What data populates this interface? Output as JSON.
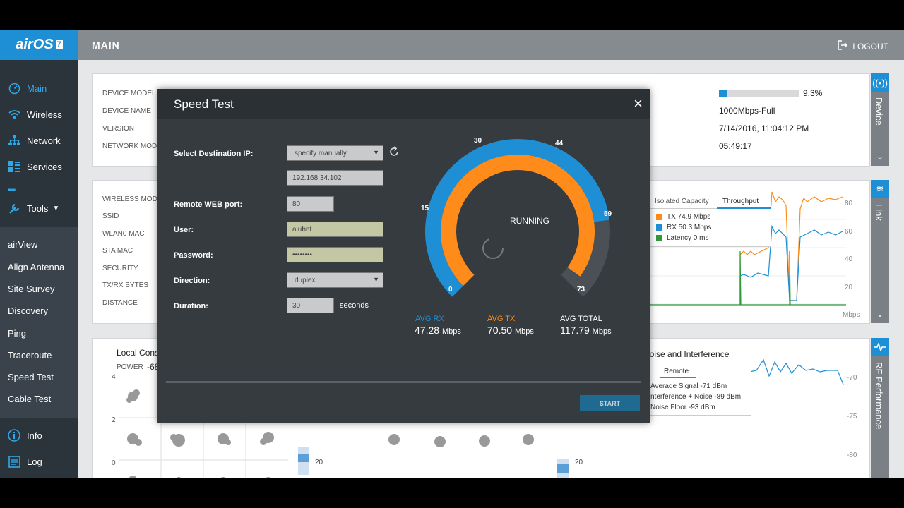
{
  "app": {
    "logo": "airOS",
    "logo_version": "7"
  },
  "header": {
    "title": "MAIN",
    "logout": "LOGOUT"
  },
  "sidebar": {
    "items": [
      {
        "label": "Main",
        "icon": "gauge-icon"
      },
      {
        "label": "Wireless",
        "icon": "wifi-icon"
      },
      {
        "label": "Network",
        "icon": "network-icon"
      },
      {
        "label": "Services",
        "icon": "services-icon"
      },
      {
        "label": "Tools",
        "icon": "wrench-icon"
      }
    ],
    "tools": [
      "airView",
      "Align Antenna",
      "Site Survey",
      "Discovery",
      "Ping",
      "Traceroute",
      "Speed Test",
      "Cable Test"
    ],
    "bottom": [
      {
        "label": "Info",
        "icon": "info-icon"
      },
      {
        "label": "Log",
        "icon": "log-icon"
      }
    ]
  },
  "device": {
    "labels": [
      "DEVICE MODEL",
      "DEVICE NAME",
      "VERSION",
      "NETWORK MODE"
    ],
    "cpu_pct": "9.3%",
    "cpu_fraction": 0.093,
    "lan_speed": "1000Mbps-Full",
    "date": "7/14/2016, 11:04:12 PM",
    "uptime": "05:49:17",
    "tab": "Device"
  },
  "link": {
    "labels": [
      "WIRELESS MODE",
      "SSID",
      "WLAN0 MAC",
      "STA MAC",
      "SECURITY",
      "TX/RX BYTES",
      "DISTANCE"
    ],
    "tab": "Link",
    "tabs": [
      "Isolated Capacity",
      "Throughput"
    ],
    "legend": [
      "TX 74.9 Mbps",
      "RX 50.3 Mbps",
      "Latency 0 ms"
    ],
    "axis": [
      "80",
      "60",
      "40",
      "20",
      "Mbps"
    ]
  },
  "rf": {
    "constellation_title": "Local Cons",
    "power_label": "POWER",
    "power_value": "-68",
    "y_ticks": [
      "4",
      "2",
      "0"
    ],
    "bar_tick": "20",
    "noise_title": "Noise and Interference",
    "remote_tab": "Remote",
    "legend": [
      "Average Signal -71 dBm",
      "nterference + Noise -89 dBm",
      "Noise Floor -93 dBm"
    ],
    "axis": [
      "-70",
      "-75",
      "-80"
    ],
    "tab": "RF Performance"
  },
  "speedtest": {
    "title": "Speed Test",
    "close": "×",
    "dest_label": "Select Destination IP:",
    "dest_option": "specify manually",
    "ip": "192.168.34.102",
    "port_label": "Remote WEB port:",
    "port": "80",
    "user_label": "User:",
    "user": "aiubnt",
    "password_label": "Password:",
    "password": "••••••••",
    "direction_label": "Direction:",
    "direction": "duplex",
    "duration_label": "Duration:",
    "duration": "30",
    "seconds": "seconds",
    "status": "RUNNING",
    "gauge_ticks": [
      "0",
      "15",
      "30",
      "44",
      "59",
      "73"
    ],
    "gauge_max": 73,
    "avg_tx_value": 70.5,
    "avg_total_value": 117.79,
    "avg_rx_label": "AVG RX",
    "avg_rx": "47.28",
    "avg_tx_label": "AVG TX",
    "avg_tx": "70.50",
    "avg_total_label": "AVG TOTAL",
    "avg_total": "117.79",
    "unit": "Mbps",
    "start": "START"
  },
  "colors": {
    "accent": "#1e8fd5",
    "tx": "#ff8c1a",
    "rx": "#1e8fd5",
    "latency": "#2e9a3a"
  }
}
